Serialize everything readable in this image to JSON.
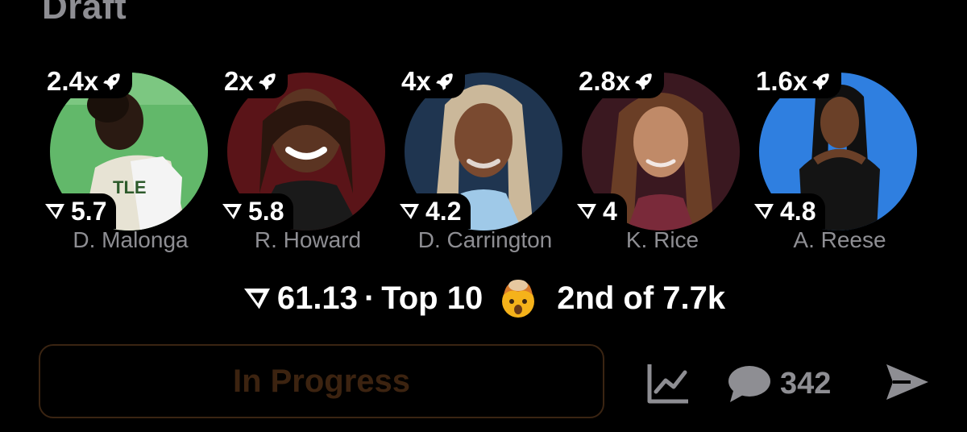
{
  "header": {
    "title": "Draft"
  },
  "players": [
    {
      "name": "D. Malonga",
      "multiplier": "2.4x",
      "score": "5.7",
      "bg": "#62b86a"
    },
    {
      "name": "R. Howard",
      "multiplier": "2x",
      "score": "5.8",
      "bg": "#5a1418"
    },
    {
      "name": "D. Carrington",
      "multiplier": "4x",
      "score": "4.2",
      "bg": "#1f3550"
    },
    {
      "name": "K. Rice",
      "multiplier": "2.8x",
      "score": "4",
      "bg": "#3a1820"
    },
    {
      "name": "A. Reese",
      "multiplier": "1.6x",
      "score": "4.8",
      "bg": "#2f7fe0"
    }
  ],
  "summary": {
    "total": "61.13",
    "separator": "·",
    "tier": "Top 10",
    "rank": "2nd of 7.7k",
    "emoji": "exploding-head"
  },
  "status_button": {
    "label": "In Progress"
  },
  "actions": {
    "comment_count": "342"
  },
  "icons": [
    "rocket-icon",
    "score-logo-icon",
    "chart-icon",
    "comment-icon",
    "send-icon"
  ],
  "colors": {
    "background": "#000000",
    "muted": "#8e8e93",
    "status_text": "#3c2310"
  }
}
